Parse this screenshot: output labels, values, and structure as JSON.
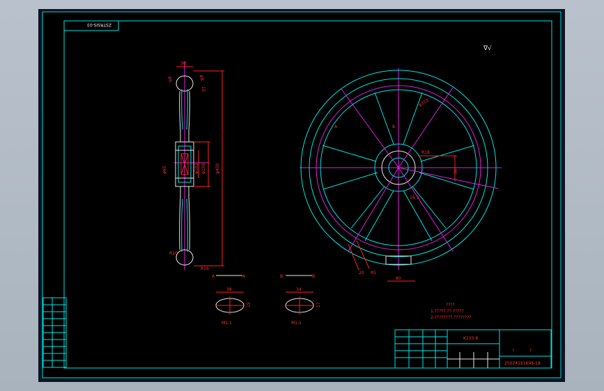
{
  "drawing": {
    "rotated_code": "ZSTRSIS-03",
    "roughness_symbol": "∇√",
    "section_a_label": "A",
    "section_b_label": "B",
    "scale_a": "M1:1",
    "scale_b": "M1:1",
    "notes_title": "????",
    "notes_line1": "1.?????,??.?????",
    "notes_line2": "2.????????.????????",
    "title_code": "K133-8",
    "part_code": "250241$169$-18",
    "title_q1": "?",
    "title_q2": "?"
  },
  "dims": {
    "hub_width": "30",
    "dim_r6": "R6",
    "dim_r8": "R8",
    "dim_15": "15",
    "dim_phi102": "φ102",
    "dim_phi150": "φ150",
    "dim_phi450": "φ450",
    "dim_phi20": "φ65",
    "dim_r10": "R10",
    "dim_r16": "R16",
    "dim_phi460": "φ310",
    "dim_a": "A",
    "dim_b": "B",
    "dim_r18": "R18",
    "dim_l": "50",
    "dim_tol": "16.3",
    "dim_80": "80",
    "dim_20": "20",
    "dim_r5": "R5",
    "sec_a_w": "38",
    "sec_a_h": "15",
    "sec_b_w": "34",
    "sec_b_h": "17"
  },
  "colors": {
    "background": "#000000",
    "frame": "#00e5e5",
    "geometry": "#e8e8e8",
    "dimension": "#ff2020",
    "centerline": "#e020e0"
  }
}
